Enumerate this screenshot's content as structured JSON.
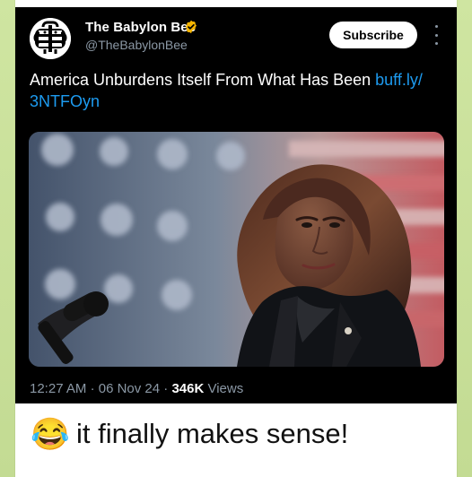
{
  "post": {
    "account_name": "The Babylon Bee",
    "handle": "@TheBabylonBee",
    "subscribe_label": "Subscribe",
    "text_main": "America Unburdens Itself From What Has Been ",
    "text_link": "buff.ly/ 3NTFOyn",
    "time": "12:27 AM",
    "date": "06 Nov 24",
    "views_count": "346K",
    "views_label": " Views",
    "link_color": "#1d9bf0"
  },
  "message": {
    "caption_emoji": "😂",
    "caption_text": "it finally makes sense!"
  },
  "icons": {
    "logo": "babylon-bee-logo",
    "verified": "verified-badge-icon",
    "more": "more-options-icon"
  }
}
